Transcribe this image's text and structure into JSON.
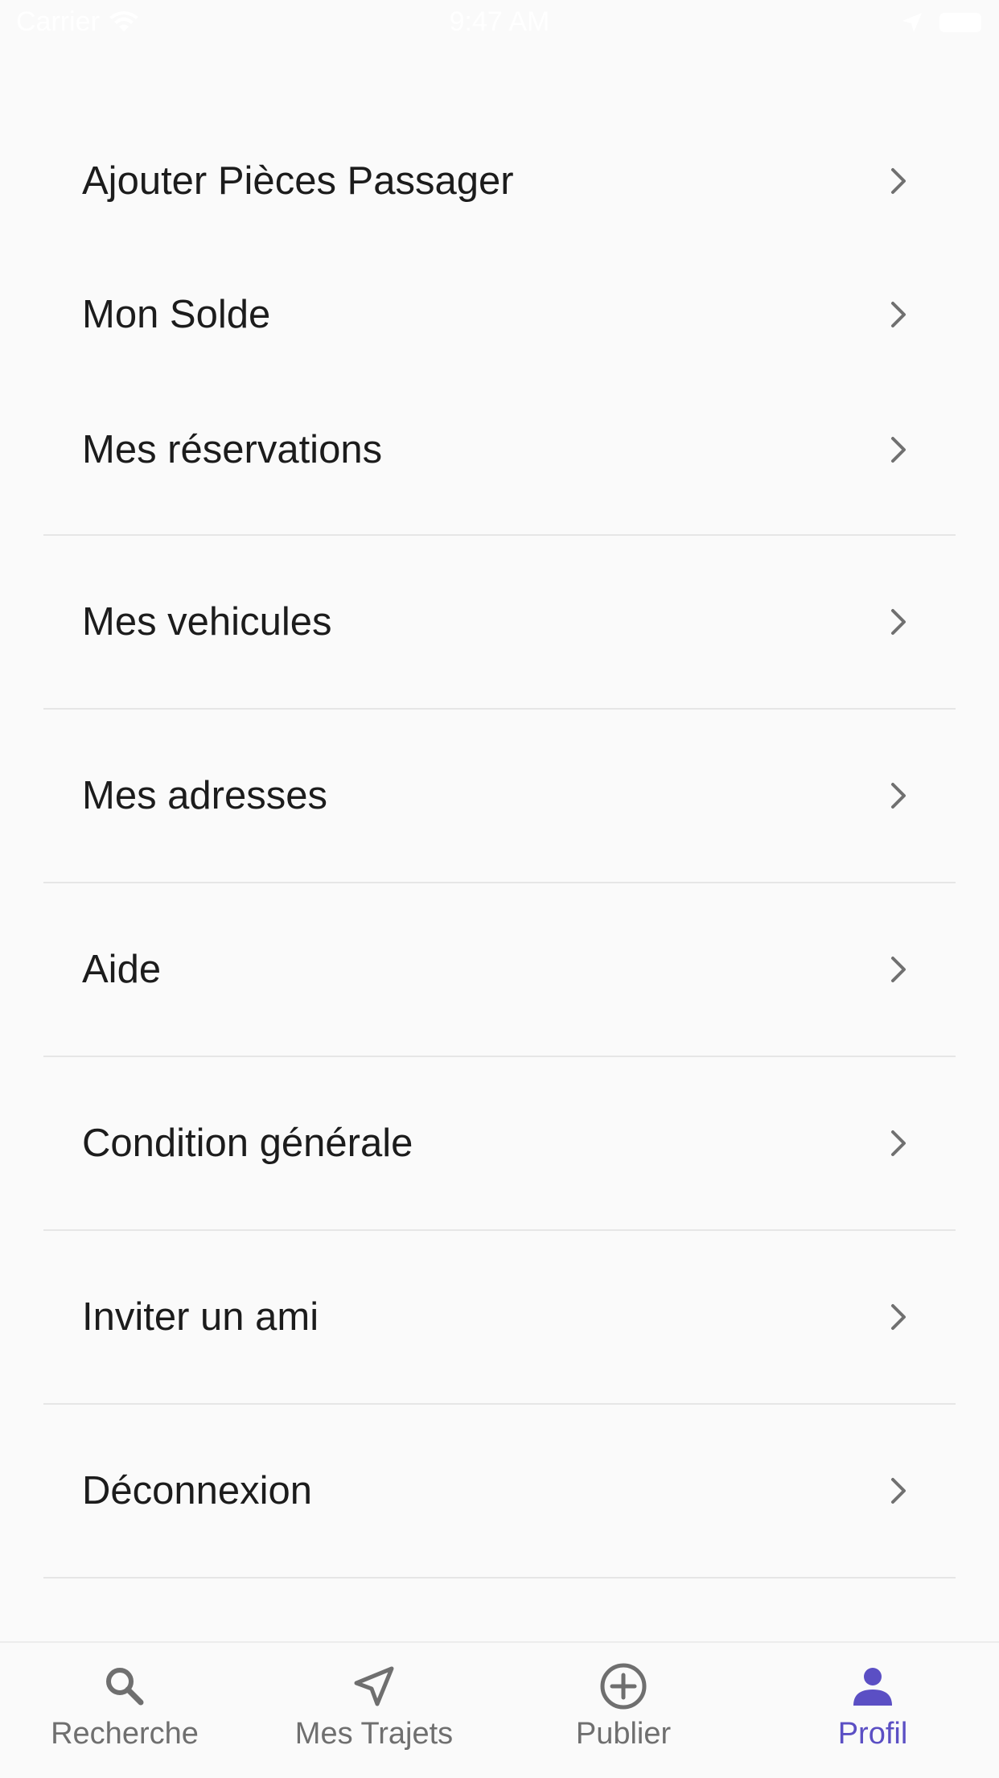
{
  "status_bar": {
    "carrier": "Carrier",
    "time": "9:47 AM"
  },
  "menu": {
    "items": [
      {
        "label": "Ajouter Pièces Passager"
      },
      {
        "label": "Mon Solde"
      },
      {
        "label": "Mes réservations"
      },
      {
        "label": "Mes vehicules"
      },
      {
        "label": "Mes adresses"
      },
      {
        "label": "Aide"
      },
      {
        "label": "Condition générale"
      },
      {
        "label": "Inviter un ami"
      },
      {
        "label": "Déconnexion"
      }
    ]
  },
  "tab_bar": {
    "tabs": [
      {
        "label": "Recherche",
        "icon": "search-icon"
      },
      {
        "label": "Mes Trajets",
        "icon": "navigation-arrow-icon"
      },
      {
        "label": "Publier",
        "icon": "add-circle-icon"
      },
      {
        "label": "Profil",
        "icon": "person-icon",
        "active": true
      }
    ],
    "active_color": "#5b4fc4",
    "inactive_color": "#6f6f6f"
  }
}
